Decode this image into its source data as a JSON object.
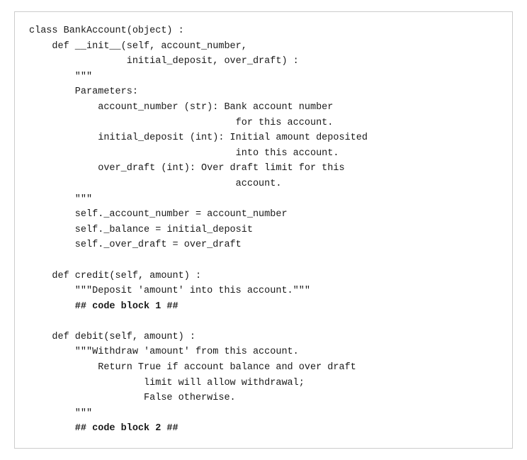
{
  "code": {
    "lines": [
      {
        "id": "l1",
        "text": "class BankAccount(object) :",
        "bold": false
      },
      {
        "id": "l2",
        "text": "    def __init__(self, account_number,",
        "bold": false
      },
      {
        "id": "l3",
        "text": "                 initial_deposit, over_draft) :",
        "bold": false
      },
      {
        "id": "l4",
        "text": "        \"\"\"",
        "bold": false
      },
      {
        "id": "l5",
        "text": "        Parameters:",
        "bold": false
      },
      {
        "id": "l6",
        "text": "            account_number (str): Bank account number",
        "bold": false
      },
      {
        "id": "l7",
        "text": "                                    for this account.",
        "bold": false
      },
      {
        "id": "l8",
        "text": "            initial_deposit (int): Initial amount deposited",
        "bold": false
      },
      {
        "id": "l9",
        "text": "                                    into this account.",
        "bold": false
      },
      {
        "id": "l10",
        "text": "            over_draft (int): Over draft limit for this",
        "bold": false
      },
      {
        "id": "l11",
        "text": "                                    account.",
        "bold": false
      },
      {
        "id": "l12",
        "text": "        \"\"\"",
        "bold": false
      },
      {
        "id": "l13",
        "text": "        self._account_number = account_number",
        "bold": false
      },
      {
        "id": "l14",
        "text": "        self._balance = initial_deposit",
        "bold": false
      },
      {
        "id": "l15",
        "text": "        self._over_draft = over_draft",
        "bold": false
      },
      {
        "id": "l16",
        "text": "",
        "bold": false
      },
      {
        "id": "l17",
        "text": "    def credit(self, amount) :",
        "bold": false
      },
      {
        "id": "l18",
        "text": "        \"\"\"Deposit 'amount' into this account.\"\"\"",
        "bold": false
      },
      {
        "id": "l19",
        "text": "        ## code block 1 ##",
        "bold": true
      },
      {
        "id": "l20",
        "text": "",
        "bold": false
      },
      {
        "id": "l21",
        "text": "    def debit(self, amount) :",
        "bold": false
      },
      {
        "id": "l22",
        "text": "        \"\"\"Withdraw 'amount' from this account.",
        "bold": false
      },
      {
        "id": "l23",
        "text": "            Return True if account balance and over draft",
        "bold": false
      },
      {
        "id": "l24",
        "text": "                    limit will allow withdrawal;",
        "bold": false
      },
      {
        "id": "l25",
        "text": "                    False otherwise.",
        "bold": false
      },
      {
        "id": "l26",
        "text": "        \"\"\"",
        "bold": false
      },
      {
        "id": "l27",
        "text": "        ## code block 2 ##",
        "bold": true
      }
    ]
  }
}
